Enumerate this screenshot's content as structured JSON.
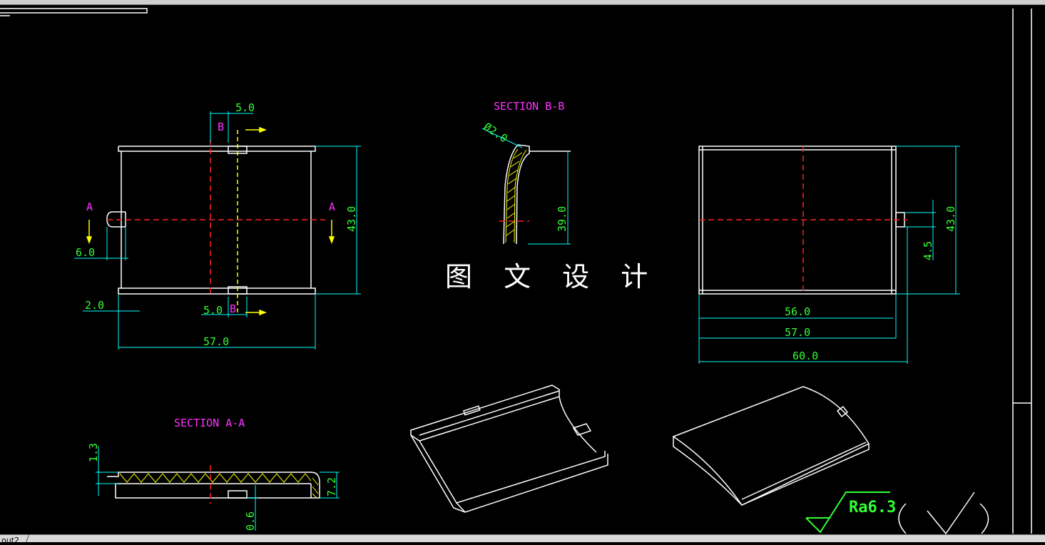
{
  "colors": {
    "background": "#000000",
    "outline": "#ffffff",
    "dimension": "#00ffff",
    "dimension_text": "#33ff33",
    "centerline": "#ff2020",
    "section_label": "#ff33ff",
    "arrow": "#ffff00"
  },
  "watermark_title": "图 文 设 计",
  "tab": {
    "label": "out2"
  },
  "view_left": {
    "dim_top_slot": "5.0",
    "label_b_top": "B",
    "label_b_bottom": "B",
    "label_a_left": "A",
    "label_a_right": "A",
    "dim_height": "43.0",
    "dim_left_offset": "6.0",
    "dim_left_gap": "2.0",
    "dim_bottom_slot": "5.0",
    "dim_width": "57.0"
  },
  "section_b": {
    "title": "SECTION B-B",
    "dim_diameter": "Ø2.0",
    "dim_height": "39.0"
  },
  "view_right": {
    "dim_height": "43.0",
    "dim_tab": "4.5",
    "dim_inner": "56.0",
    "dim_mid": "57.0",
    "dim_overall": "60.0"
  },
  "section_a": {
    "title": "SECTION A-A",
    "dim_thickness": "1.3",
    "dim_height": "7.2",
    "dim_bottom": "0.6"
  },
  "roughness": {
    "label": "Ra6.3"
  }
}
